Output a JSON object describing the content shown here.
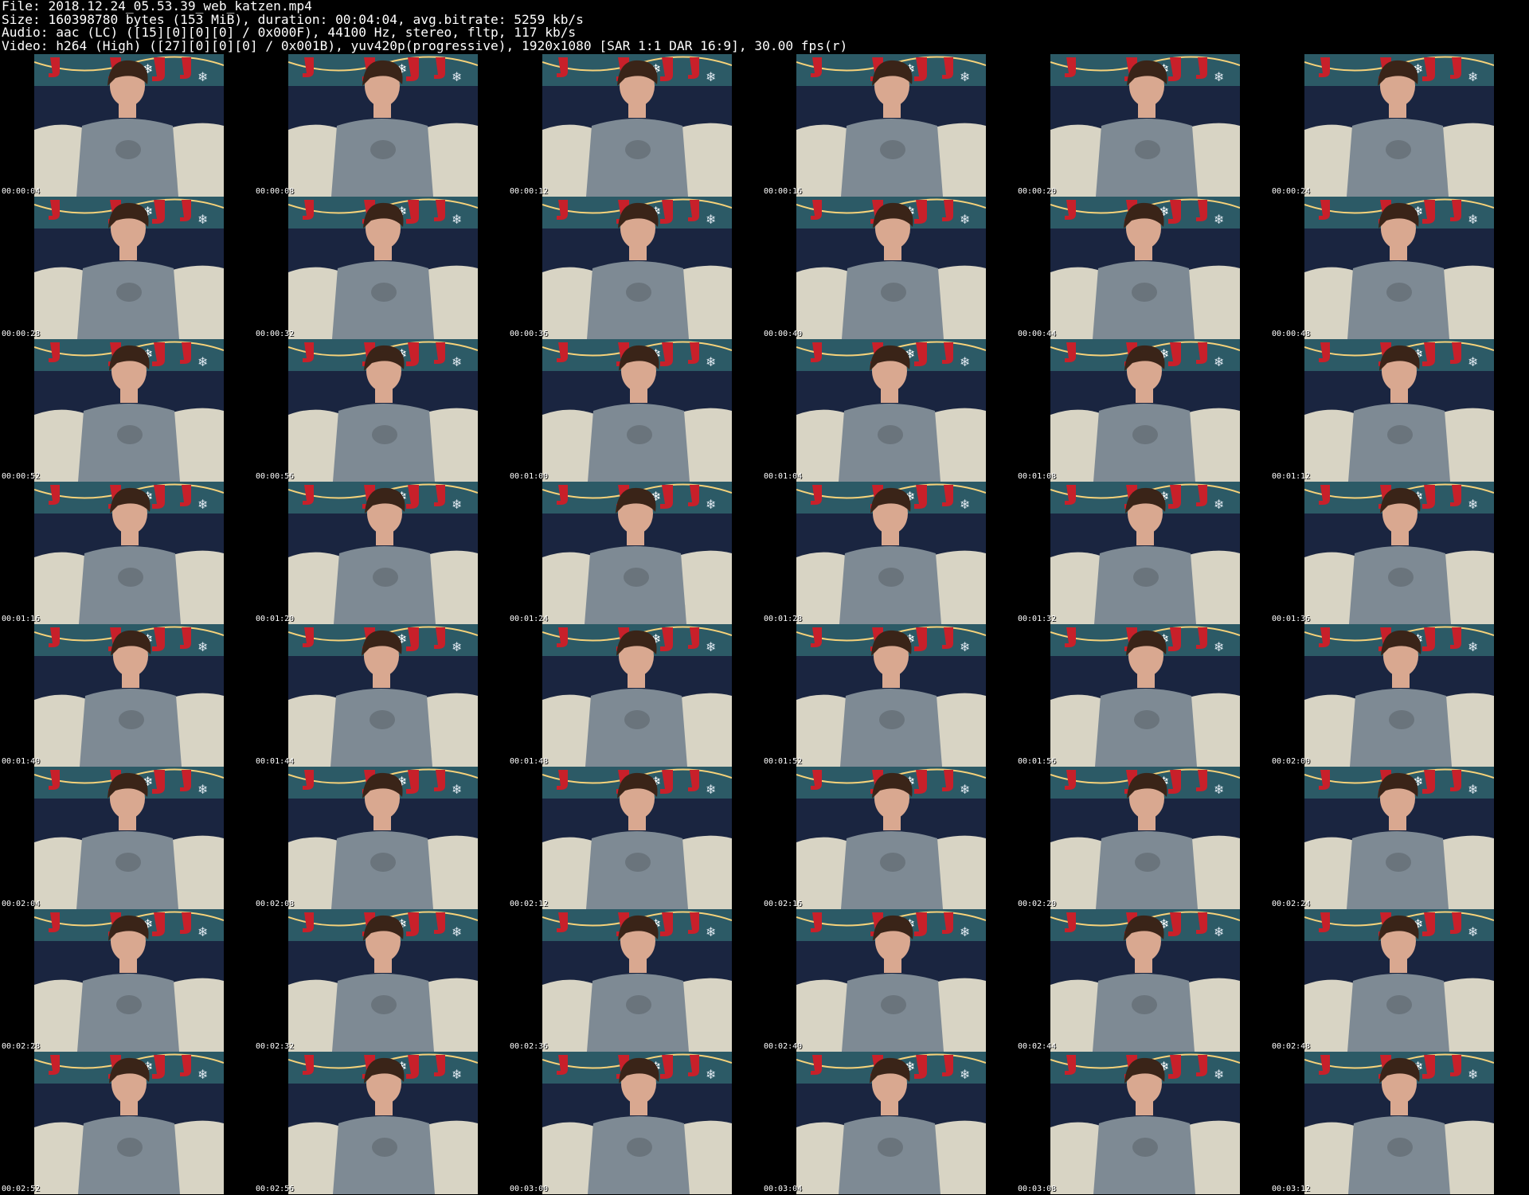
{
  "header": {
    "file_line": "File: 2018.12.24_05.53.39_web_katzen.mp4",
    "size_line": "Size: 160398780 bytes (153 MiB), duration: 00:04:04, avg.bitrate: 5259 kb/s",
    "audio_line": "Audio: aac (LC) ([15][0][0][0] / 0x000F), 44100 Hz, stereo, fltp, 117 kb/s",
    "video_line": "Video: h264 (High) ([27][0][0][0] / 0x001B), yuv420p(progressive), 1920x1080 [SAR 1:1 DAR 16:9], 30.00 fps(r)"
  },
  "thumbnails": [
    {
      "time": "00:00:04"
    },
    {
      "time": "00:00:08"
    },
    {
      "time": "00:00:12"
    },
    {
      "time": "00:00:16"
    },
    {
      "time": "00:00:20"
    },
    {
      "time": "00:00:24"
    },
    {
      "time": "00:00:28"
    },
    {
      "time": "00:00:32"
    },
    {
      "time": "00:00:36"
    },
    {
      "time": "00:00:40"
    },
    {
      "time": "00:00:44"
    },
    {
      "time": "00:00:48"
    },
    {
      "time": "00:00:52"
    },
    {
      "time": "00:00:56"
    },
    {
      "time": "00:01:00"
    },
    {
      "time": "00:01:04"
    },
    {
      "time": "00:01:08"
    },
    {
      "time": "00:01:12"
    },
    {
      "time": "00:01:16"
    },
    {
      "time": "00:01:20"
    },
    {
      "time": "00:01:24"
    },
    {
      "time": "00:01:28"
    },
    {
      "time": "00:01:32"
    },
    {
      "time": "00:01:36"
    },
    {
      "time": "00:01:40"
    },
    {
      "time": "00:01:44"
    },
    {
      "time": "00:01:48"
    },
    {
      "time": "00:01:52"
    },
    {
      "time": "00:01:56"
    },
    {
      "time": "00:02:00"
    },
    {
      "time": "00:02:04"
    },
    {
      "time": "00:02:08"
    },
    {
      "time": "00:02:12"
    },
    {
      "time": "00:02:16"
    },
    {
      "time": "00:02:20"
    },
    {
      "time": "00:02:24"
    },
    {
      "time": "00:02:28"
    },
    {
      "time": "00:02:32"
    },
    {
      "time": "00:02:36"
    },
    {
      "time": "00:02:40"
    },
    {
      "time": "00:02:44"
    },
    {
      "time": "00:02:48"
    },
    {
      "time": "00:02:52"
    },
    {
      "time": "00:02:56"
    },
    {
      "time": "00:03:00"
    },
    {
      "time": "00:03:04"
    },
    {
      "time": "00:03:08"
    },
    {
      "time": "00:03:12"
    }
  ],
  "colors": {
    "background": "#000000",
    "text": "#ffffff",
    "wall_blue": "#1f3550",
    "couch_navy": "#1a2540",
    "stocking_red": "#c8202a",
    "shirt_gray": "#7e8a94",
    "blanket_cream": "#d8d4c4",
    "hair_brown": "#3a2418",
    "skin": "#d9a890"
  }
}
